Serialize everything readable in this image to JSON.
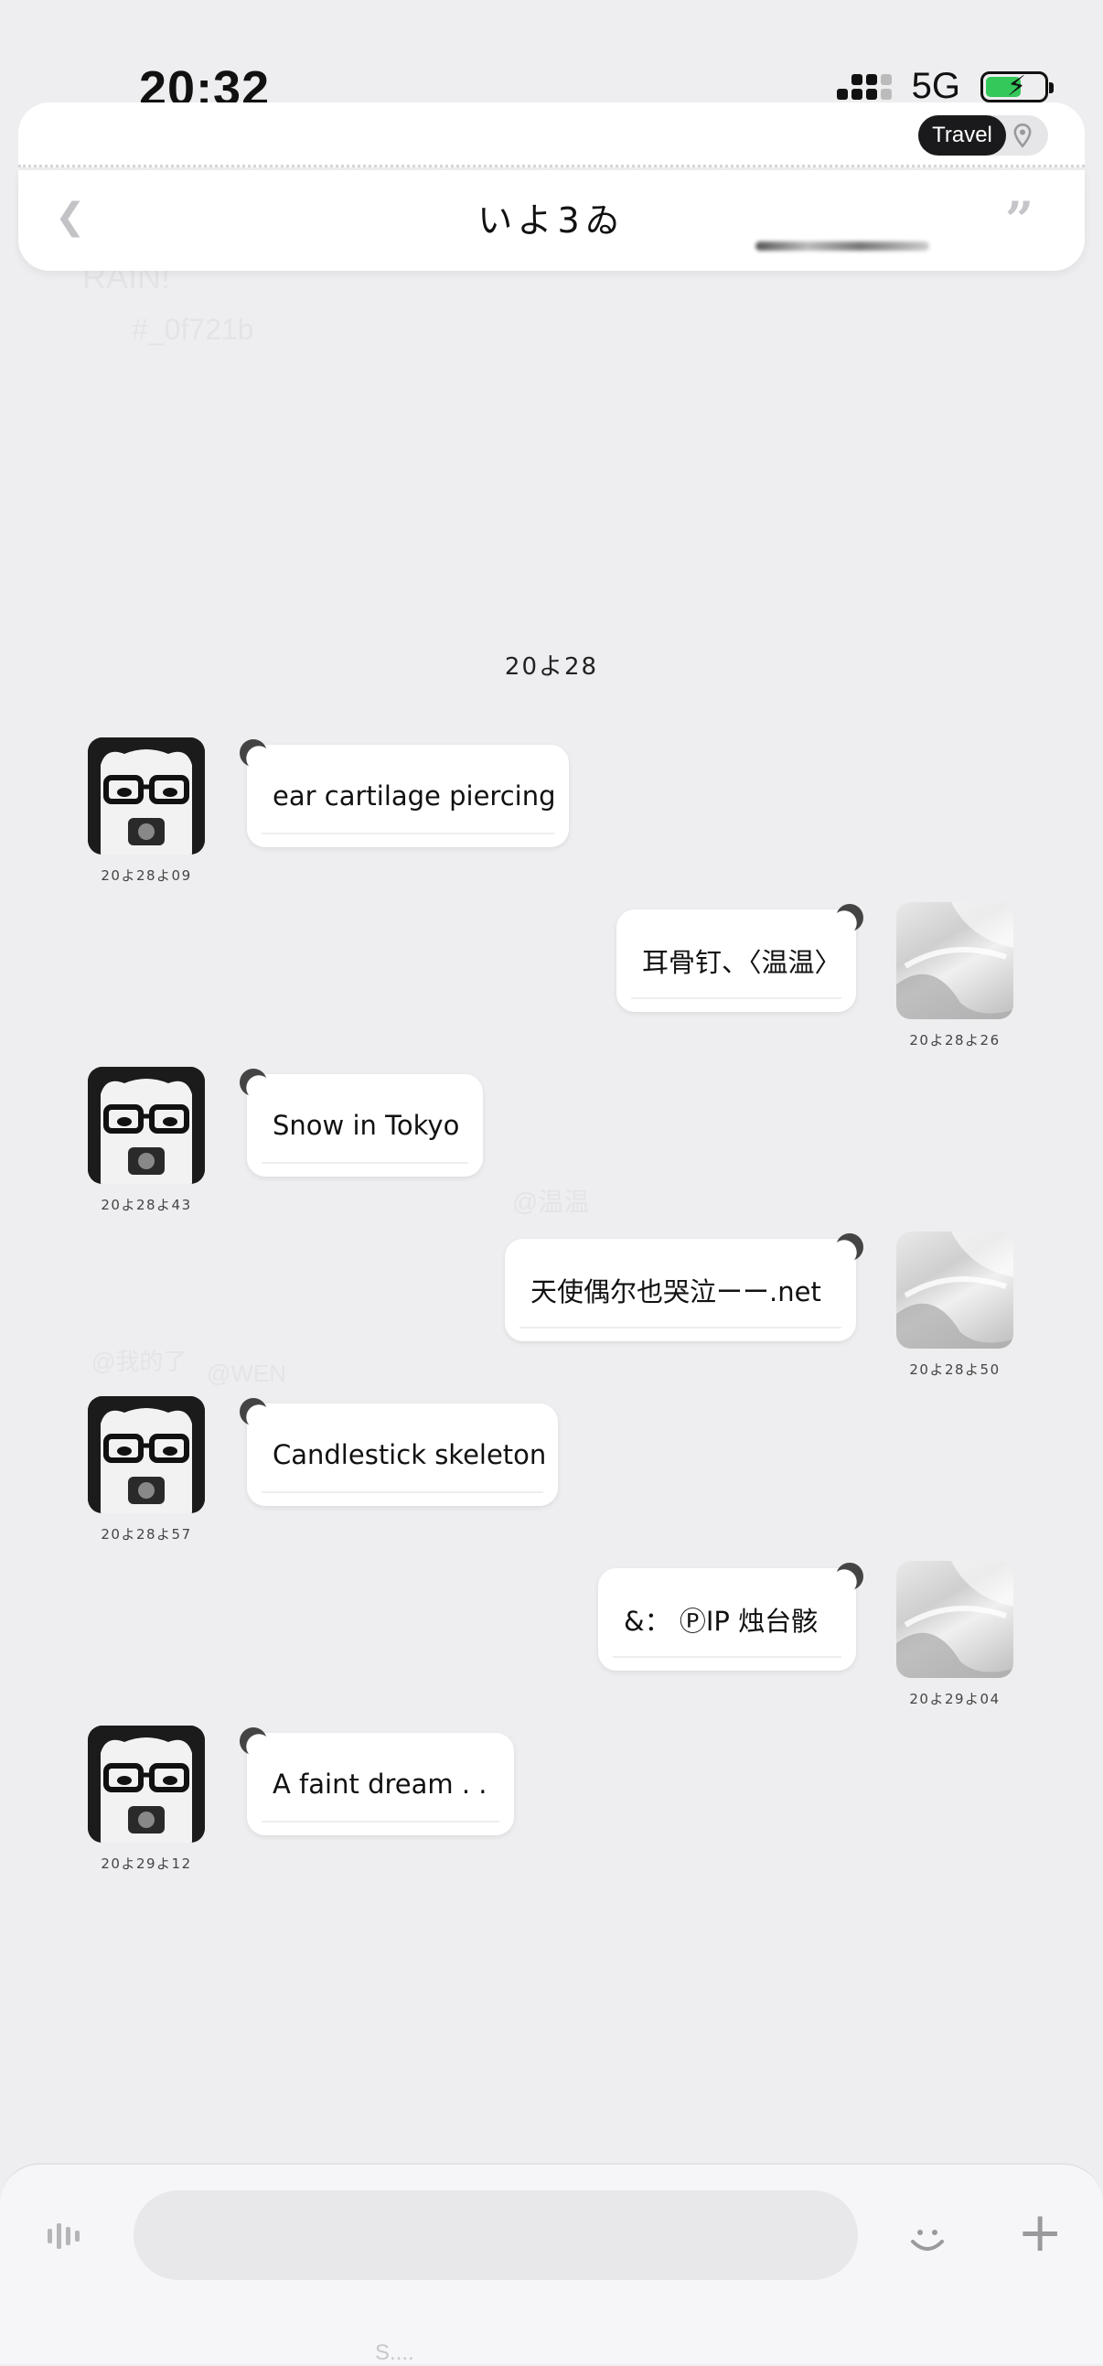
{
  "status_bar": {
    "time": "20:32",
    "network": "5G"
  },
  "header": {
    "title": "いよ3ゐ",
    "badge_label": "Travel"
  },
  "background_text": [
    "RAIN!",
    "#_0f721b",
    "@温温",
    "@我的了",
    "@WEN"
  ],
  "chat": {
    "date_separator": "20よ28",
    "messages": [
      {
        "side": "in",
        "text": "ear cartilage piercing",
        "time": "20よ28よ09"
      },
      {
        "side": "out",
        "text": "耳骨钉、〈温温〉",
        "time": "20よ28よ26"
      },
      {
        "side": "in",
        "text": "Snow in Tokyo",
        "time": "20よ28よ43"
      },
      {
        "side": "out",
        "text": "天使偶尔也哭泣ーー.net",
        "time": "20よ28よ50"
      },
      {
        "side": "in",
        "text": "Candlestick skeleton",
        "time": "20よ28よ57"
      },
      {
        "side": "out",
        "text": "&： ⓅIP 烛台骸",
        "time": "20よ29よ04"
      },
      {
        "side": "in",
        "text": "A faint dream . .",
        "time": "20よ29よ12"
      }
    ]
  },
  "input": {
    "placeholder": "",
    "hint": "S...."
  },
  "icons": {
    "back": "chevron-left-icon",
    "quote": "quote-icon",
    "location": "pin-icon",
    "voice": "voice-wave-icon",
    "emoji": "smile-icon",
    "add": "plus-icon"
  },
  "colors": {
    "background": "#eeeef0",
    "battery": "#34c759",
    "badge": "#1a1a1c"
  }
}
